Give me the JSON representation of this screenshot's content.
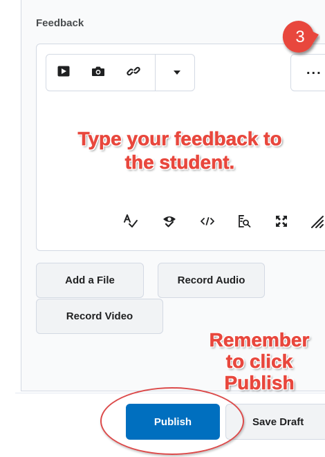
{
  "feedback": {
    "label": "Feedback"
  },
  "editor": {
    "toolbar": [
      {
        "icon": "video-play-icon"
      },
      {
        "icon": "camera-icon"
      },
      {
        "icon": "link-icon"
      },
      {
        "icon": "dropdown-caret-icon"
      }
    ],
    "more_label": "...",
    "bottom_tools": [
      {
        "icon": "spellcheck-icon"
      },
      {
        "icon": "accessibility-check-icon"
      },
      {
        "icon": "source-code-icon"
      },
      {
        "icon": "preview-icon"
      },
      {
        "icon": "fullscreen-icon"
      },
      {
        "icon": "resize-handle-icon"
      }
    ]
  },
  "attachments": {
    "add_file_label": "Add a File",
    "record_audio_label": "Record Audio",
    "record_video_label": "Record Video"
  },
  "footer": {
    "publish_label": "Publish",
    "save_draft_label": "Save Draft"
  },
  "annotations": {
    "step_number": "3",
    "instruction_line1": "Type your feedback to",
    "instruction_line2": "the student.",
    "reminder_line1": "Remember",
    "reminder_line2": "to click",
    "reminder_line3": "Publish"
  },
  "colors": {
    "accent": "#006fbf",
    "annotation": "#e8473d",
    "badge": "#e8473d"
  }
}
